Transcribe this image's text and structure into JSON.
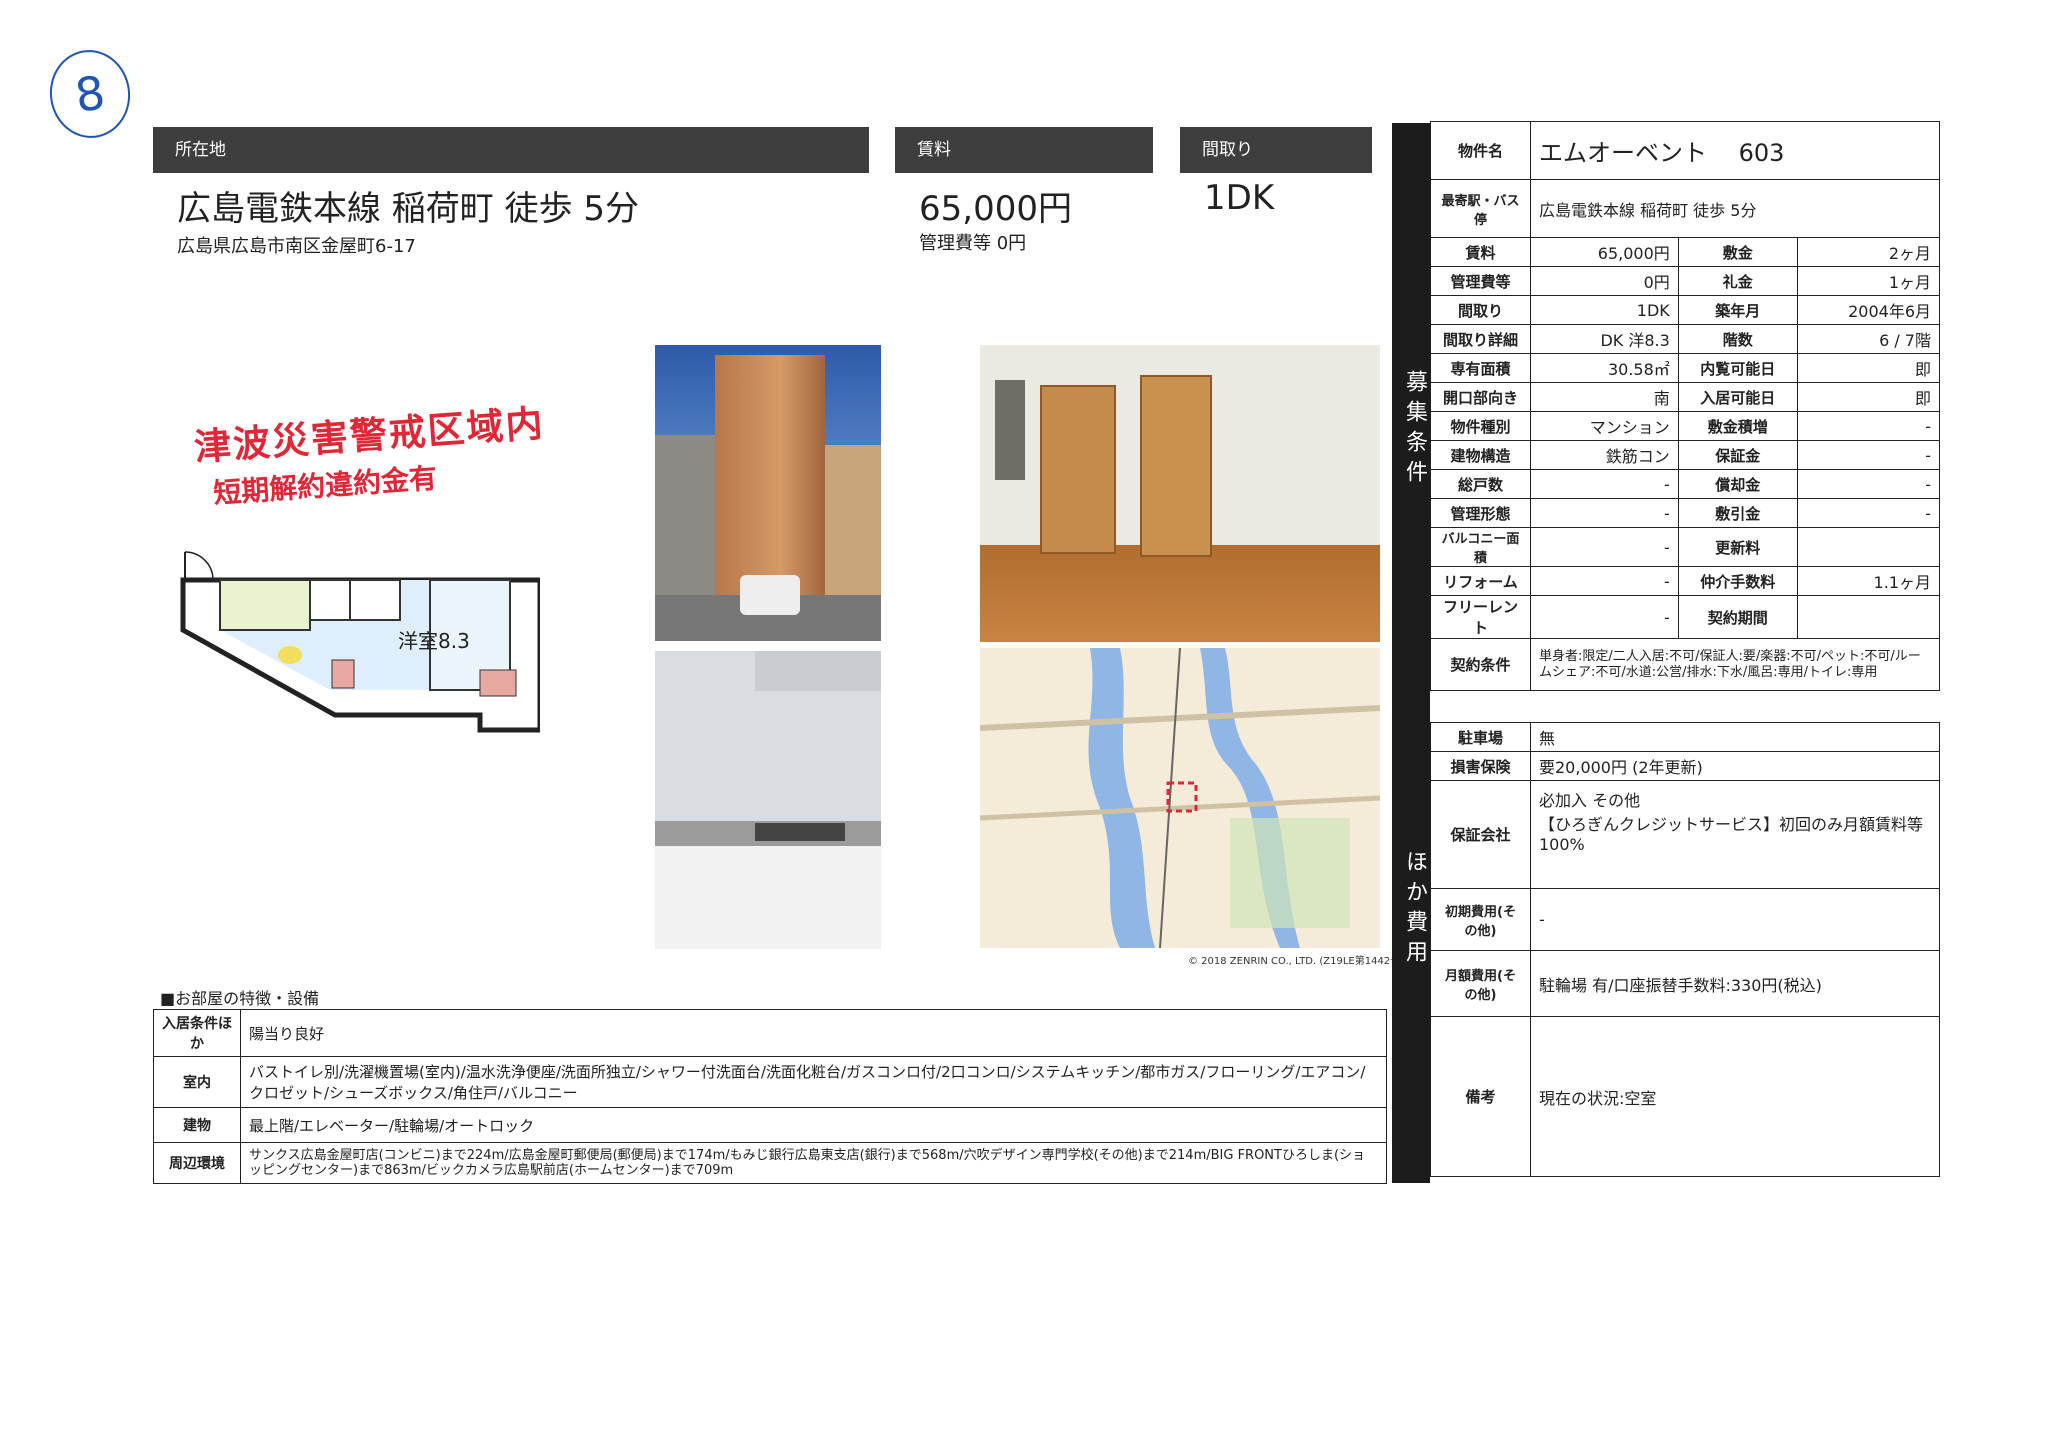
{
  "page_marker": "8",
  "location": {
    "header": "所在地",
    "line": "広島電鉄本線 稲荷町 徒歩 5分",
    "address": "広島県広島市南区金屋町6-17"
  },
  "rent": {
    "header": "賃料",
    "amount": "65,000円",
    "mgmt": "管理費等 0円"
  },
  "layout": {
    "header": "間取り",
    "value": "1DK"
  },
  "notice": {
    "line1": "津波災害警戒区域内",
    "line2": "短期解約違約金有"
  },
  "floorplan": {
    "room_label": "洋室8.3"
  },
  "map": {
    "copyright": "© 2018 ZENRIN CO., LTD. (Z19LE第1442号)"
  },
  "features": {
    "section_title": "■お部屋の特徴・設備",
    "rows": [
      {
        "label": "入居条件ほか",
        "value": "陽当り良好"
      },
      {
        "label": "室内",
        "value": "バストイレ別/洗濯機置場(室内)/温水洗浄便座/洗面所独立/シャワー付洗面台/洗面化粧台/ガスコンロ付/2口コンロ/システムキッチン/都市ガス/フローリング/エアコン/クロゼット/シューズボックス/角住戸/バルコニー"
      },
      {
        "label": "建物",
        "value": "最上階/エレベーター/駐輪場/オートロック"
      },
      {
        "label": "周辺環境",
        "value": "サンクス広島金屋町店(コンビニ)まで224m/広島金屋町郵便局(郵便局)まで174m/もみじ銀行広島東支店(銀行)まで568m/穴吹デザイン専門学校(その他)まで214m/BIG FRONTひろしま(ショッピングセンター)まで863m/ビックカメラ広島駅前店(ホームセンター)まで709m"
      }
    ]
  },
  "spec": {
    "side_label_1": "募集条件",
    "side_label_2": "ほか費用",
    "property_name_label": "物件名",
    "property_name": "エムオーベント　 603",
    "station_label": "最寄駅・バス停",
    "station": "広島電鉄本線 稲荷町 徒歩 5分",
    "rows": [
      {
        "l1": "賃料",
        "v1": "65,000円",
        "l2": "敷金",
        "v2": "2ヶ月"
      },
      {
        "l1": "管理費等",
        "v1": "0円",
        "l2": "礼金",
        "v2": "1ヶ月"
      },
      {
        "l1": "間取り",
        "v1": "1DK",
        "l2": "築年月",
        "v2": "2004年6月"
      },
      {
        "l1": "間取り詳細",
        "v1": "DK 洋8.3",
        "l2": "階数",
        "v2": "6 / 7階"
      },
      {
        "l1": "専有面積",
        "v1": "30.58㎡",
        "l2": "内覧可能日",
        "v2": "即"
      },
      {
        "l1": "開口部向き",
        "v1": "南",
        "l2": "入居可能日",
        "v2": "即"
      },
      {
        "l1": "物件種別",
        "v1": "マンション",
        "l2": "敷金積増",
        "v2": "-"
      },
      {
        "l1": "建物構造",
        "v1": "鉄筋コン",
        "l2": "保証金",
        "v2": "-"
      },
      {
        "l1": "総戸数",
        "v1": "-",
        "l2": "償却金",
        "v2": "-"
      },
      {
        "l1": "管理形態",
        "v1": "-",
        "l2": "敷引金",
        "v2": "-"
      },
      {
        "l1": "バルコニー面積",
        "v1": "-",
        "l2": "更新料",
        "v2": ""
      },
      {
        "l1": "リフォーム",
        "v1": "-",
        "l2": "仲介手数料",
        "v2": "1.1ヶ月"
      },
      {
        "l1": "フリーレント",
        "v1": "-",
        "l2": "契約期間",
        "v2": ""
      }
    ],
    "contract_label": "契約条件",
    "contract": "単身者:限定/二人入居:不可/保証人:要/楽器:不可/ペット:不可/ルームシェア:不可/水道:公営/排水:下水/風呂:専用/トイレ:専用",
    "parking_label": "駐車場",
    "parking": "無",
    "insurance_label": "損害保険",
    "insurance": "要20,000円 (2年更新)",
    "guarantor_label": "保証会社",
    "guarantor": "必加入 その他\n【ひろぎんクレジットサービス】初回のみ月額賃料等100%",
    "initial_label": "初期費用(その他)",
    "initial": "-",
    "monthly_label": "月額費用(その他)",
    "monthly": "駐輪場 有/口座振替手数料:330円(税込)",
    "remarks_label": "備考",
    "remarks": "現在の状況:空室"
  }
}
